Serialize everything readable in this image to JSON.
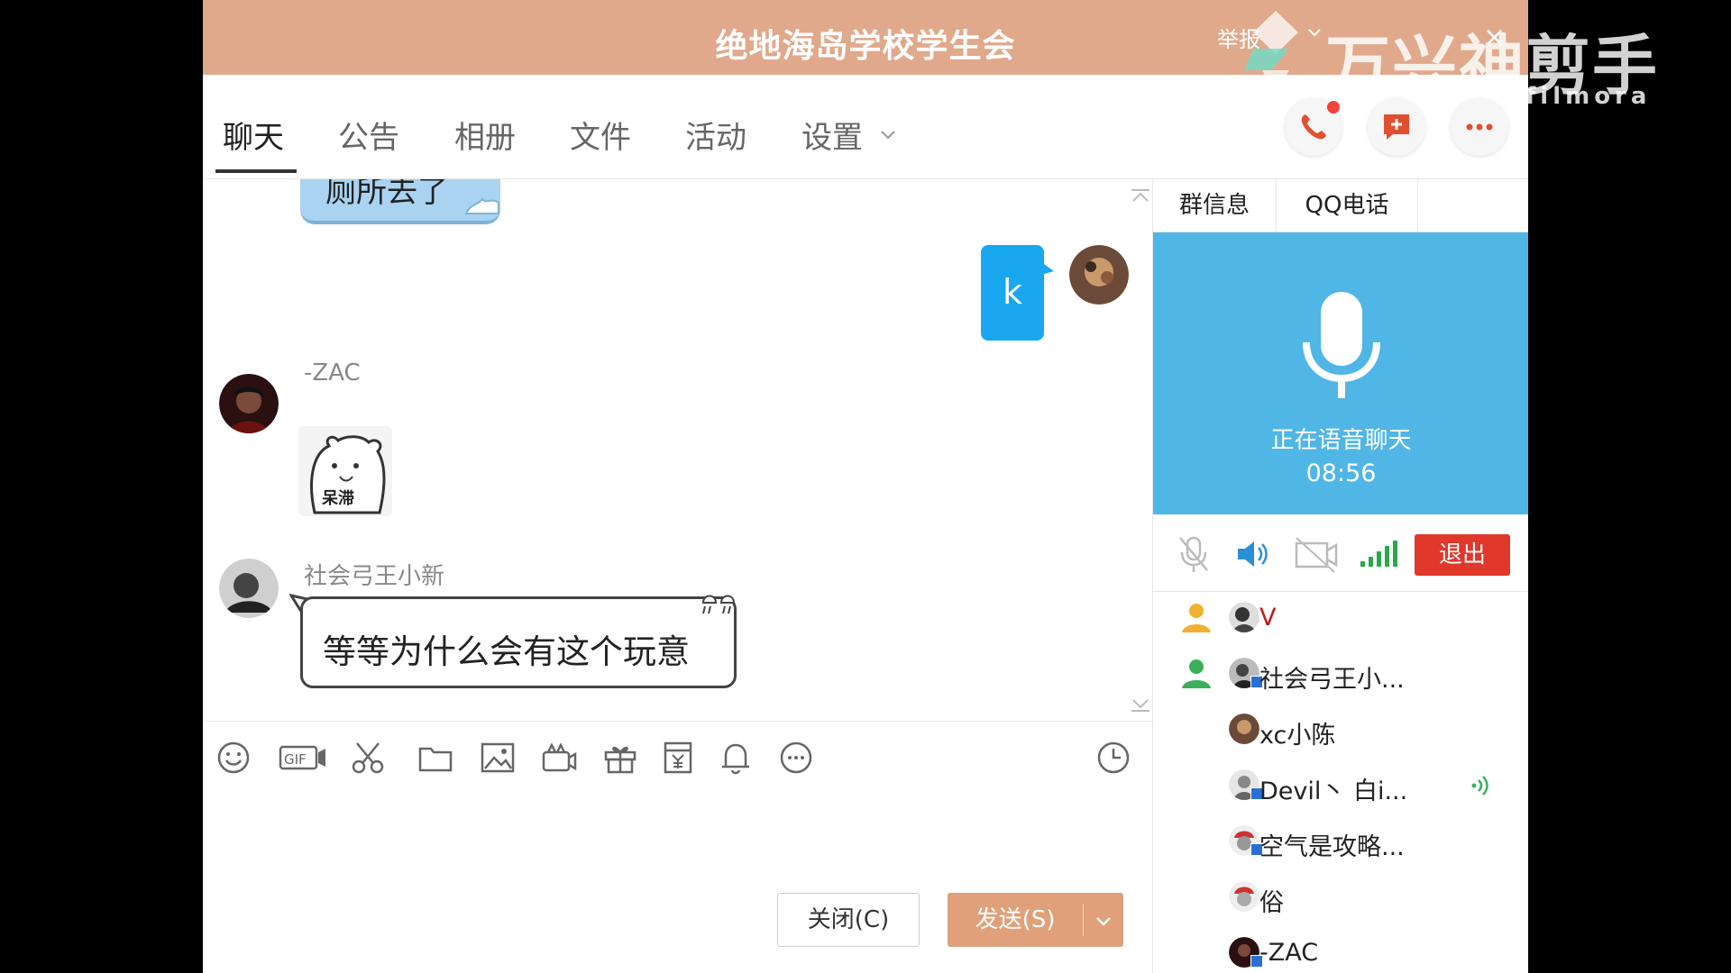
{
  "window": {
    "title": "绝地海岛学校学生会",
    "report_label": "举报",
    "close_label": "×"
  },
  "watermark": {
    "text": "万兴神剪手",
    "sub": "filmora"
  },
  "tabs": [
    {
      "label": "聊天",
      "active": true
    },
    {
      "label": "公告"
    },
    {
      "label": "相册"
    },
    {
      "label": "文件"
    },
    {
      "label": "活动"
    },
    {
      "label": "设置"
    }
  ],
  "header_actions": [
    "phone-icon",
    "add-chat-icon",
    "more-icon"
  ],
  "chat": {
    "partial_message": "厕所去了",
    "my_message": "k",
    "msg1": {
      "sender": "-ZAC",
      "sticker_text": "呆滞"
    },
    "msg2": {
      "sender": "社会弓王小新",
      "text": "等等为什么会有这个玩意"
    }
  },
  "toolbar_icons": [
    "emoji-icon",
    "gif-icon",
    "scissors-icon",
    "folder-icon",
    "image-icon",
    "video-call-icon",
    "gift-icon",
    "red-packet-icon",
    "bell-icon",
    "more-icon",
    "history-icon"
  ],
  "buttons": {
    "close": "关闭(C)",
    "send": "发送(S)"
  },
  "right_panel": {
    "tabs": [
      "群信息",
      "QQ电话"
    ],
    "voice_status": "正在语音聊天",
    "voice_time": "08:56",
    "exit_label": "退出",
    "members": [
      {
        "name": "V",
        "admin": true,
        "color": "#c21818"
      },
      {
        "name": "社会弓王小...",
        "admin": true
      },
      {
        "name": "xc小陈"
      },
      {
        "name": "Devil丶 白i...",
        "speaking": true
      },
      {
        "name": "空气是攻略..."
      },
      {
        "name": "俗"
      },
      {
        "name": "-ZAC"
      }
    ]
  },
  "colors": {
    "titlebar": "#e0a98c",
    "voice_bg": "#50b6e6",
    "exit": "#e0382b",
    "send": "#e0a07a",
    "my_bubble": "#19a7ef"
  }
}
